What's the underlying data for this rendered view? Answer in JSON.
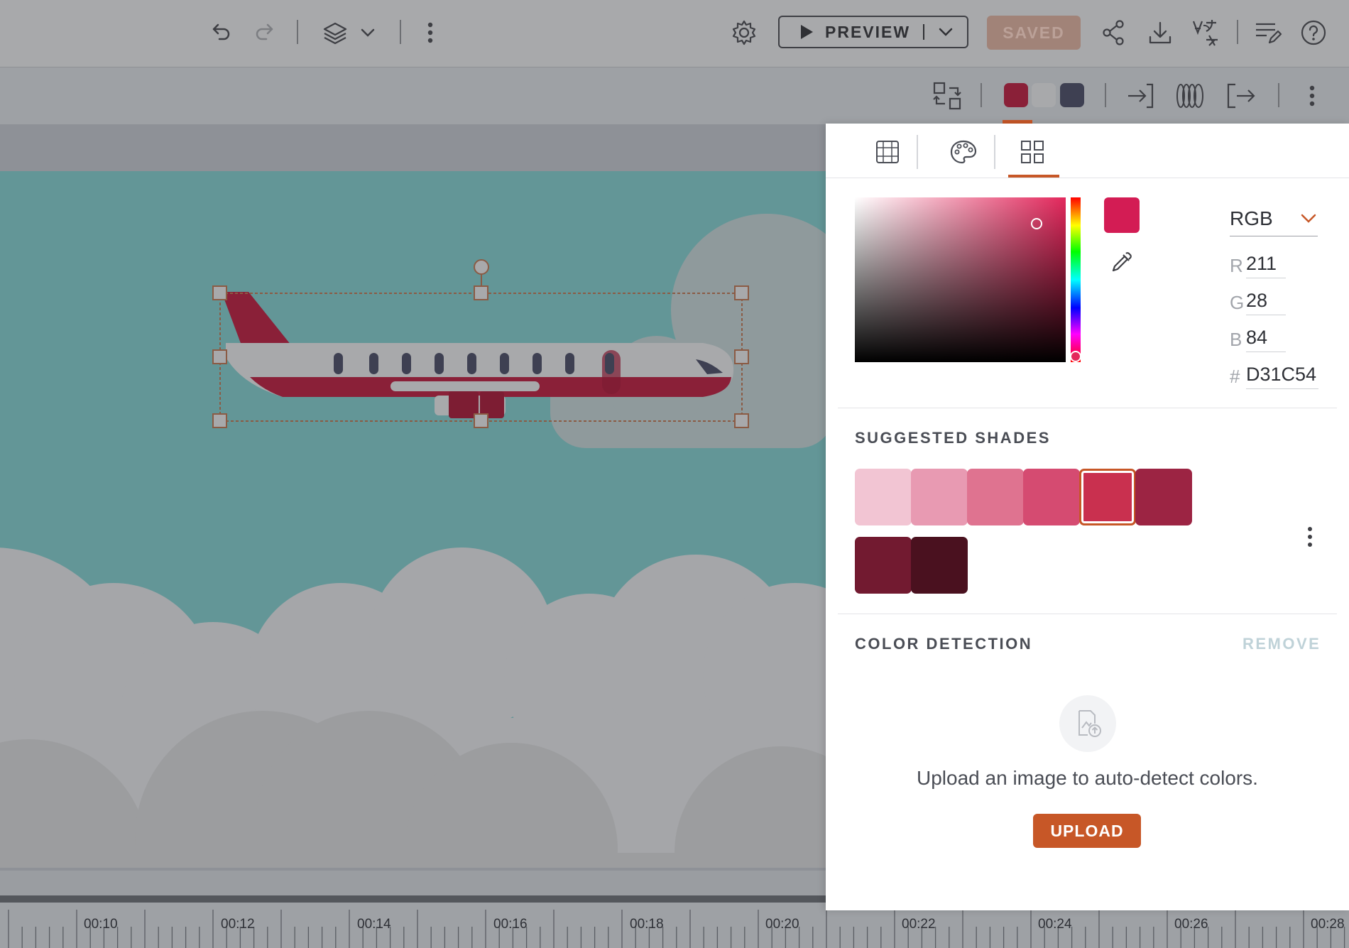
{
  "toolbar": {
    "preview_label": "PREVIEW",
    "saved_label": "SAVED",
    "icons": [
      "undo-icon",
      "redo-icon",
      "layers-icon",
      "chevron-down-icon",
      "more-vert-icon",
      "settings-icon",
      "play-icon",
      "share-icon",
      "download-icon",
      "translate-icon",
      "edit-notes-icon",
      "help-icon"
    ]
  },
  "subbar": {
    "swatches": [
      "#8a2038",
      "#a8a9ab",
      "#3e4052"
    ],
    "icons": [
      "swap-layout-icon",
      "enter-animation-icon",
      "motion-icon",
      "exit-animation-icon",
      "more-vert-icon"
    ]
  },
  "color_panel": {
    "tabs": [
      "grid-icon",
      "palette-icon",
      "swatches-icon"
    ],
    "active_tab": 2,
    "current_color": "#D31C54",
    "mode_label": "RGB",
    "r_label": "R",
    "r_value": "211",
    "g_label": "G",
    "g_value": "28",
    "b_label": "B",
    "b_value": "84",
    "hex_label": "#",
    "hex_value": "D31C54",
    "suggested_title": "SUGGESTED SHADES",
    "shades": [
      "#f2c5d3",
      "#e89ab2",
      "#df7390",
      "#d54b71",
      "#c9304f",
      "#9c2443",
      "#721a30",
      "#4a111f"
    ],
    "selected_shade": 4,
    "detection_title": "COLOR DETECTION",
    "remove_label": "REMOVE",
    "upload_text": "Upload an image to auto-detect colors.",
    "upload_label": "UPLOAD"
  },
  "timeline": {
    "ticks": [
      "00:10",
      "00:12",
      "00:14",
      "00:16",
      "00:18",
      "00:20",
      "00:22",
      "00:24",
      "00:26",
      "00:28"
    ]
  },
  "colors": {
    "accent": "#c75727",
    "stage_sky": "#639697",
    "cloud": "#a5a6a9"
  }
}
